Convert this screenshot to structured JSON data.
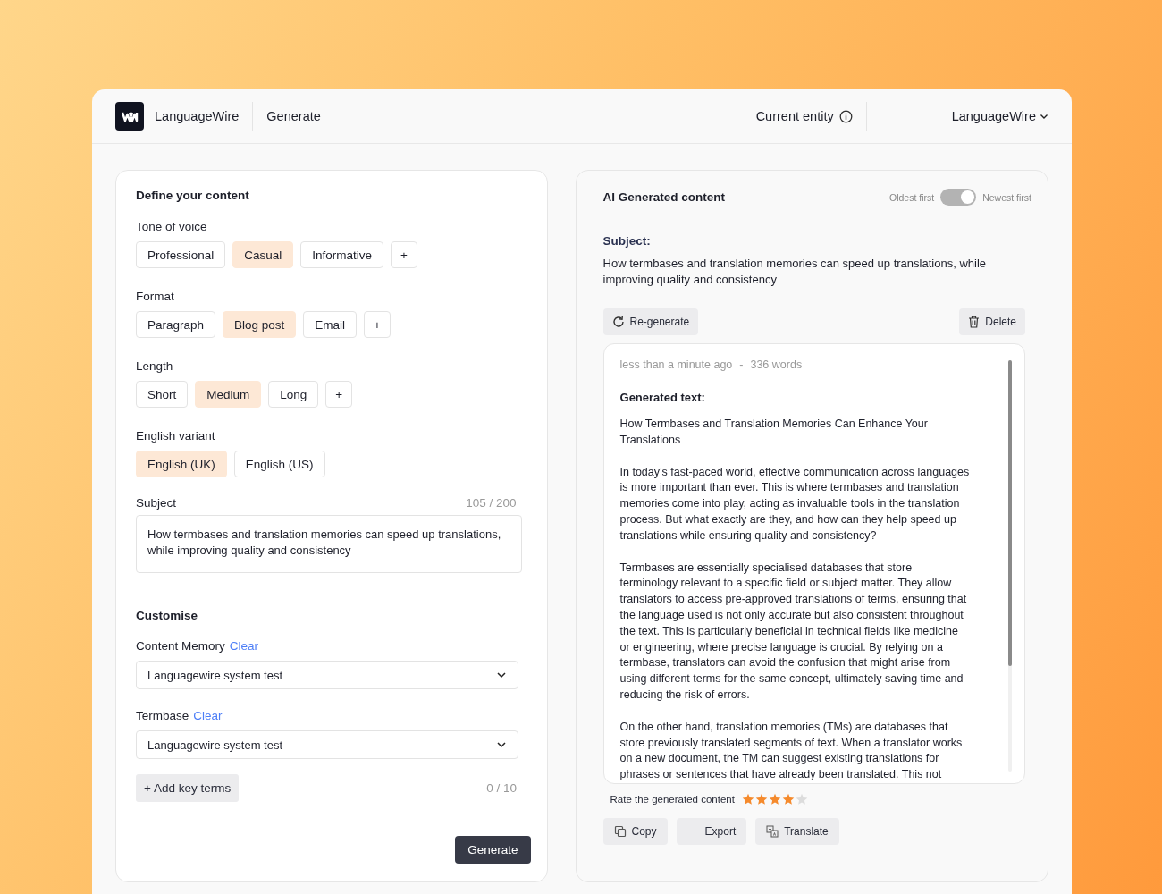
{
  "header": {
    "brand": "LanguageWire",
    "nav": "Generate",
    "entity_label": "Current entity",
    "account": "LanguageWire"
  },
  "define": {
    "title": "Define your content",
    "groups": [
      {
        "label": "Tone of voice",
        "add": "+",
        "options": [
          {
            "label": "Professional",
            "selected": false
          },
          {
            "label": "Casual",
            "selected": true
          },
          {
            "label": "Informative",
            "selected": false
          }
        ]
      },
      {
        "label": "Format",
        "add": "+",
        "options": [
          {
            "label": "Paragraph",
            "selected": false
          },
          {
            "label": "Blog post",
            "selected": true
          },
          {
            "label": "Email",
            "selected": false
          }
        ]
      },
      {
        "label": "Length",
        "add": "+",
        "options": [
          {
            "label": "Short",
            "selected": false
          },
          {
            "label": "Medium",
            "selected": true
          },
          {
            "label": "Long",
            "selected": false
          }
        ]
      },
      {
        "label": "English variant",
        "options": [
          {
            "label": "English (UK)",
            "selected": true
          },
          {
            "label": "English (US)",
            "selected": false
          }
        ]
      }
    ],
    "subject": {
      "label": "Subject",
      "count": "105 / 200",
      "value": "How termbases and translation memories can speed up translations, while improving quality and consistency"
    },
    "customise": {
      "title": "Customise",
      "selects": [
        {
          "label": "Content Memory",
          "clear": "Clear",
          "value": "Languagewire system test"
        },
        {
          "label": "Termbase",
          "clear": "Clear",
          "value": "Languagewire system test"
        }
      ],
      "add_terms": "+  Add key terms",
      "terms_count": "0 / 10"
    },
    "generate": "Generate"
  },
  "generated": {
    "title": "AI Generated content",
    "sort_left": "Oldest first",
    "sort_right": "Newest first",
    "newest_first": true,
    "subject_label": "Subject:",
    "subject": "How termbases and translation memories can speed up translations, while improving quality and consistency",
    "regenerate": "Re-generate",
    "delete": "Delete",
    "meta_time": "less than a minute ago",
    "meta_sep": "-",
    "meta_words": "336 words",
    "text_label": "Generated text:",
    "paragraphs": [
      "How Termbases and Translation Memories Can Enhance Your Translations",
      "In today’s fast-paced world, effective communication across languages is more important than ever. This is where termbases and translation memories come into play, acting as invaluable tools in the translation process. But what exactly are they, and how can they help speed up translations while ensuring quality and consistency?",
      "Termbases are essentially specialised databases that store terminology relevant to a specific field or subject matter. They allow translators to access pre-approved translations of terms, ensuring that the language used is not only accurate but also consistent throughout the text. This is particularly beneficial in technical fields like medicine or engineering, where precise language is crucial. By relying on a termbase, translators can avoid the confusion that might arise from using different terms for the same concept, ultimately saving time and reducing the risk of errors.",
      "On the other hand, translation memories (TMs) are databases that store previously translated segments of text. When a translator works on a new document, the TM can suggest existing translations for phrases or sentences that have already been translated. This not"
    ],
    "rating_label": "Rate the generated content",
    "stars": 4,
    "actions": [
      {
        "label": "Copy",
        "kind": "copy"
      },
      {
        "label": "Export",
        "kind": "export"
      },
      {
        "label": "Translate",
        "kind": "translate"
      }
    ]
  }
}
